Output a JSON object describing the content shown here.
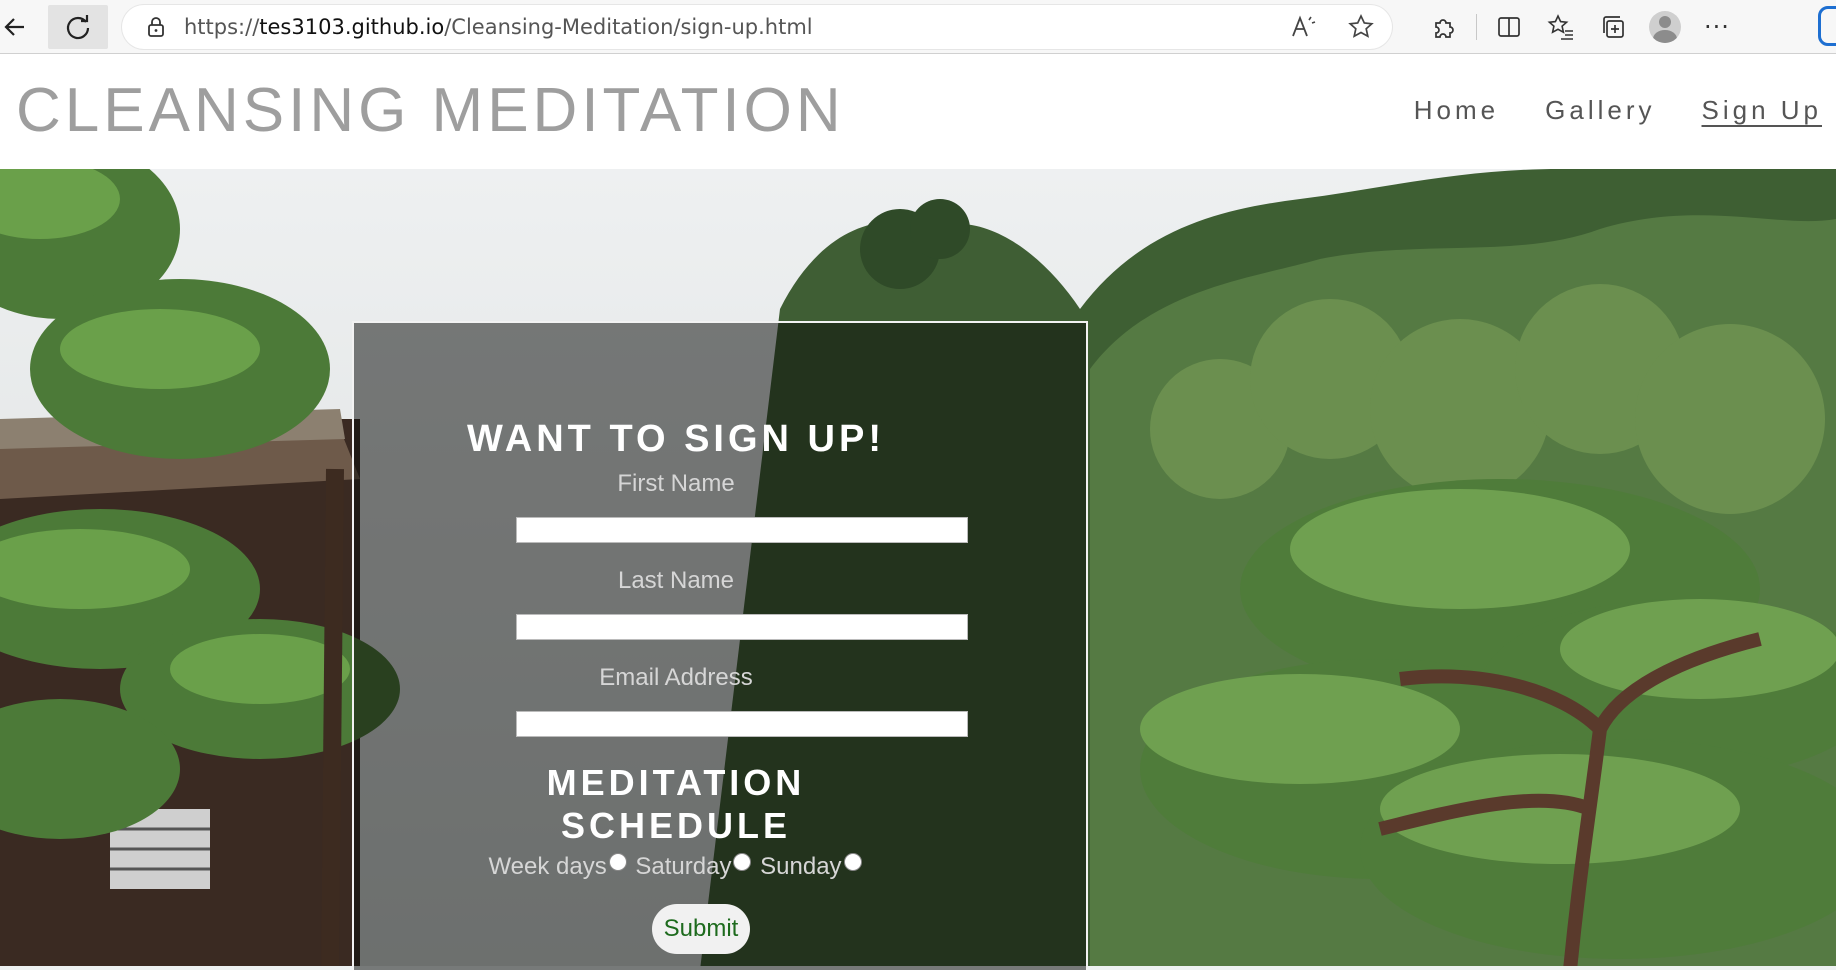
{
  "browser": {
    "url_prefix": "https://",
    "url_host": "tes3103.github.io",
    "url_path": "/Cleansing-Meditation/sign-up.html",
    "icons": {
      "back": "back-arrow-icon",
      "reload": "reload-icon",
      "lock": "lock-icon",
      "read_aloud": "read-aloud-icon",
      "favorite": "star-icon",
      "extensions": "puzzle-icon",
      "split_screen": "split-screen-icon",
      "favorites": "favorites-list-icon",
      "collections": "collections-icon",
      "profile": "profile-avatar-icon",
      "more": "more-dots-icon"
    },
    "more_label": "···"
  },
  "site": {
    "logo": "CLEANSING MEDITATION",
    "nav": [
      {
        "label": "Home"
      },
      {
        "label": "Gallery"
      },
      {
        "label": "Sign Up",
        "active": true
      }
    ]
  },
  "form": {
    "title": "WANT TO SIGN UP!",
    "fields": [
      {
        "label": "First Name",
        "value": ""
      },
      {
        "label": "Last Name",
        "value": ""
      },
      {
        "label": "Email Address",
        "value": ""
      }
    ],
    "schedule_title_line1": "MEDITATION",
    "schedule_title_line2": "SCHEDULE",
    "schedule_options": [
      {
        "label": "Week days",
        "checked": false
      },
      {
        "label": "Saturday",
        "checked": false
      },
      {
        "label": "Sunday",
        "checked": false
      }
    ],
    "submit_label": "Submit"
  },
  "colors": {
    "logo": "#9e9e9e",
    "nav_text": "#555555",
    "panel_overlay": "rgba(10,12,10,0.52)",
    "submit_text": "#1e6b1e"
  }
}
